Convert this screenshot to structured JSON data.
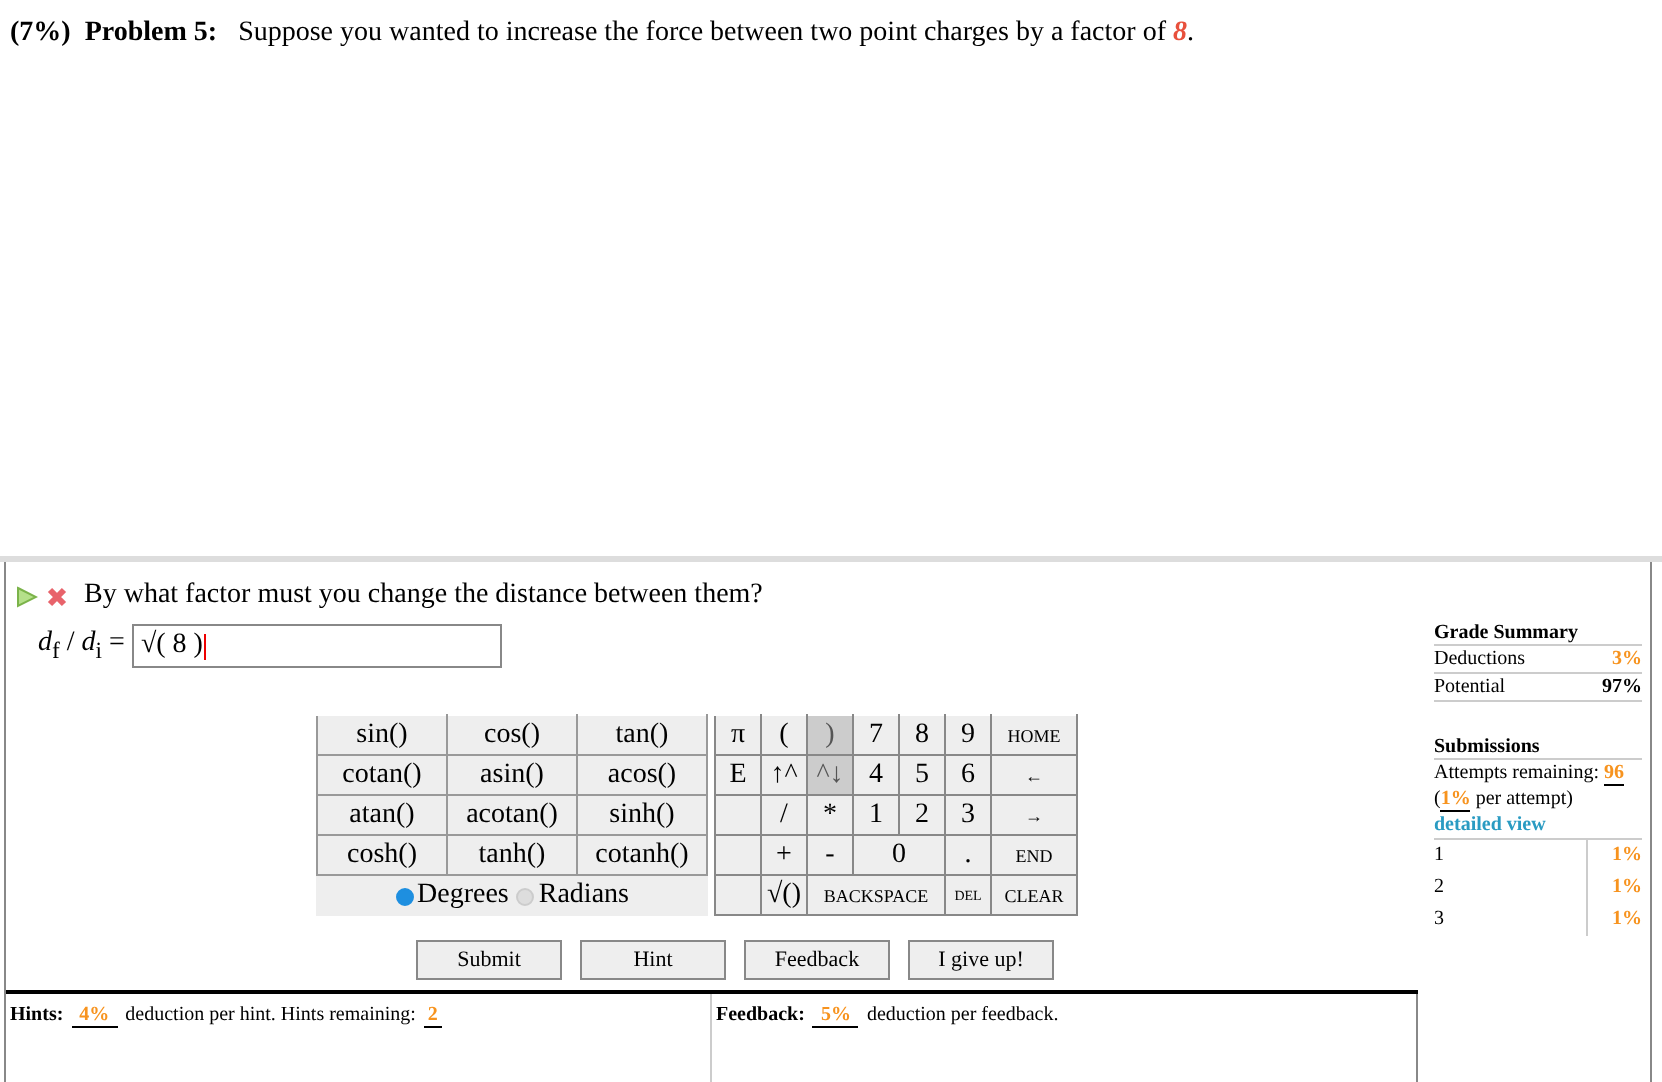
{
  "problem": {
    "weight": "(7%)",
    "label": "Problem 5:",
    "statement": "Suppose you wanted to increase the force between two point charges by a factor of **8**."
  },
  "question": {
    "text": "By what factor must you change the distance between them?",
    "variable": "*d*$_{f}$ / *d*$_{i}$ =",
    "value": "√( 8 )"
  },
  "functions": [
    [
      "sin()",
      "cos()",
      "tan()"
    ],
    [
      "cotan()",
      "asin()",
      "acos()"
    ],
    [
      "atan()",
      "acotan()",
      "sinh()"
    ],
    [
      "cosh()",
      "tanh()",
      "cotanh()"
    ]
  ],
  "angle_modes": [
    {
      "label": "Degrees",
      "selected": true
    },
    {
      "label": "Radians",
      "selected": false
    }
  ],
  "keypad": [
    [
      {
        "label": "π",
        "kind": "normal",
        "disabled": false
      },
      {
        "label": "(",
        "kind": "normal",
        "disabled": false
      },
      {
        "label": ")",
        "kind": "normal",
        "disabled": true
      },
      {
        "label": "7",
        "kind": "normal",
        "disabled": false
      },
      {
        "label": "8",
        "kind": "normal",
        "disabled": false
      },
      {
        "label": "9",
        "kind": "normal",
        "disabled": false
      },
      {
        "label": "HOME",
        "kind": "small",
        "disabled": false
      }
    ],
    [
      {
        "label": "E",
        "kind": "normal",
        "disabled": false
      },
      {
        "label": "↑^",
        "kind": "normal",
        "disabled": false
      },
      {
        "label": "^↓",
        "kind": "normal",
        "disabled": true
      },
      {
        "label": "4",
        "kind": "normal",
        "disabled": false
      },
      {
        "label": "5",
        "kind": "normal",
        "disabled": false
      },
      {
        "label": "6",
        "kind": "normal",
        "disabled": false
      },
      {
        "label": "←",
        "kind": "small",
        "disabled": false
      }
    ],
    [
      {
        "kind": "blank"
      },
      {
        "label": "/",
        "kind": "normal",
        "disabled": false
      },
      {
        "label": "*",
        "kind": "normal",
        "disabled": false
      },
      {
        "label": "1",
        "kind": "normal",
        "disabled": false
      },
      {
        "label": "2",
        "kind": "normal",
        "disabled": false
      },
      {
        "label": "3",
        "kind": "normal",
        "disabled": false
      },
      {
        "label": "→",
        "kind": "small",
        "disabled": false
      }
    ],
    [
      {
        "kind": "blank"
      },
      {
        "label": "+",
        "kind": "normal",
        "disabled": false
      },
      {
        "label": "-",
        "kind": "normal",
        "disabled": false
      },
      {
        "label": "0",
        "kind": "wide",
        "disabled": false
      },
      {
        "label": ".",
        "kind": "normal",
        "disabled": false
      },
      {
        "label": "END",
        "kind": "small",
        "disabled": false
      }
    ],
    [
      {
        "kind": "blank"
      },
      {
        "label": "√()",
        "kind": "normal",
        "disabled": false
      },
      {
        "label": "BACKSPACE",
        "kind": "wide-small",
        "disabled": false
      },
      {
        "label": "DEL",
        "kind": "tiny",
        "disabled": false
      },
      {
        "label": "CLEAR",
        "kind": "small",
        "disabled": false
      }
    ]
  ],
  "buttons": [
    "Submit",
    "Hint",
    "Feedback",
    "I give up!"
  ],
  "hints": {
    "label": "Hints:",
    "deduction": "4%",
    "text": "deduction per hint. Hints remaining:",
    "remaining": "2"
  },
  "feedback": {
    "label": "Feedback:",
    "deduction": "5%",
    "text": "deduction per feedback."
  },
  "grade_summary": {
    "title": "Grade Summary",
    "rows": [
      {
        "label": "Deductions",
        "value": "3%",
        "kind": "deduction"
      },
      {
        "label": "Potential",
        "value": "97%",
        "kind": "total"
      }
    ]
  },
  "submissions": {
    "title": "Submissions",
    "attempts_label": "Attempts remaining:",
    "attempts": "96",
    "per_attempt_open": "(",
    "per_attempt": "1%",
    "per_attempt_text": "per attempt)",
    "detail_link": "detailed view",
    "list": [
      {
        "number": "1",
        "deduction": "1%"
      },
      {
        "number": "2",
        "deduction": "1%"
      },
      {
        "number": "3",
        "deduction": "1%"
      }
    ]
  }
}
